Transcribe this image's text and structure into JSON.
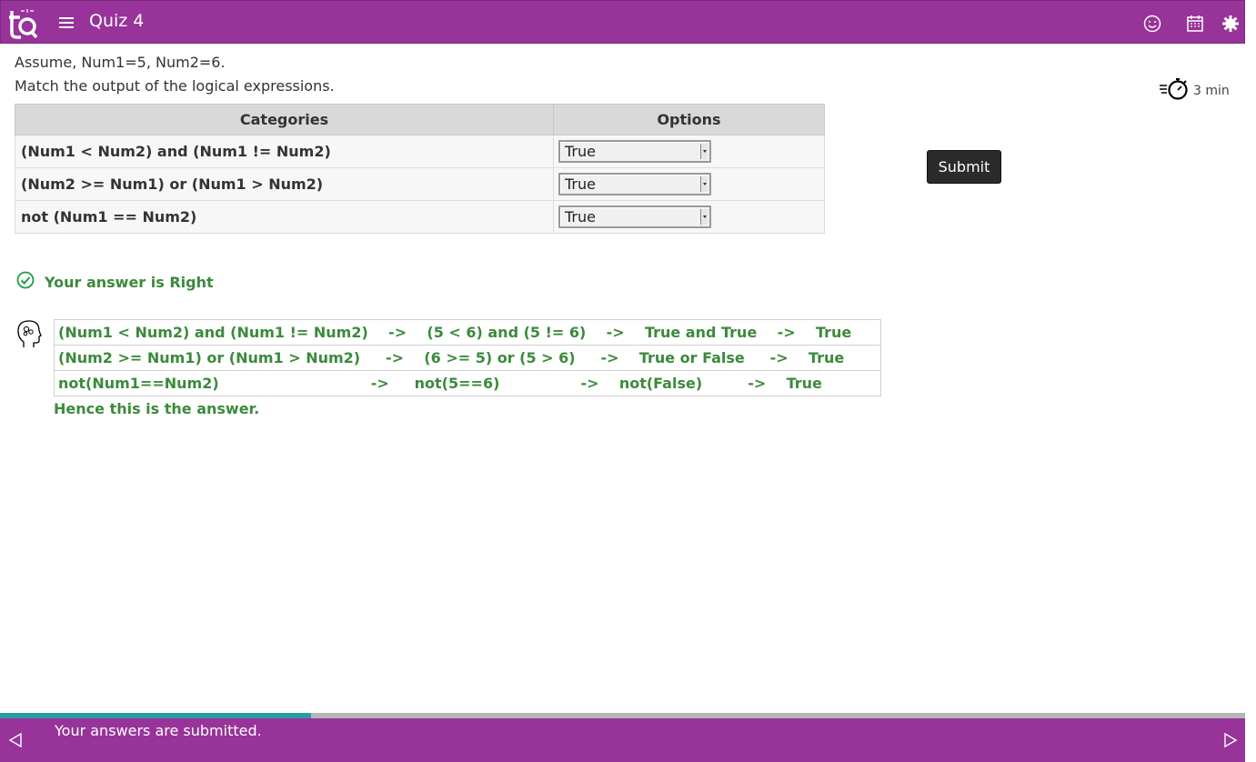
{
  "header": {
    "title": "Quiz 4"
  },
  "question": {
    "assume": "Assume, Num1=5, Num2=6.",
    "instruction": "Match the output of the logical expressions."
  },
  "timer": {
    "label": "3 min"
  },
  "match_table": {
    "headers": [
      "Categories",
      "Options"
    ],
    "rows": [
      {
        "category": "(Num1 < Num2) and (Num1 != Num2)",
        "selected": "True"
      },
      {
        "category": "(Num2 >= Num1) or (Num1 > Num2)",
        "selected": "True"
      },
      {
        "category": "not (Num1 == Num2)",
        "selected": "True"
      }
    ]
  },
  "submit_label": "Submit",
  "result": {
    "text": "Your answer is Right"
  },
  "explanation": {
    "rows": [
      "(Num1 < Num2) and (Num1 != Num2)    ->    (5 < 6) and (5 != 6)    ->    True and True    ->    True",
      "(Num2 >= Num1) or (Num1 > Num2)     ->    (6 >= 5) or (5 > 6)     ->    True or False     ->    True",
      "not(Num1==Num2)                              ->     not(5==6)                ->    not(False)         ->    True"
    ],
    "conclusion": "Hence this is the answer."
  },
  "progress": {
    "fraction": 0.25
  },
  "footer": {
    "message": "Your answers are submitted."
  },
  "colors": {
    "brand": "#973399",
    "progress_fill": "#2a9da0",
    "success": "#3c8a3c"
  }
}
